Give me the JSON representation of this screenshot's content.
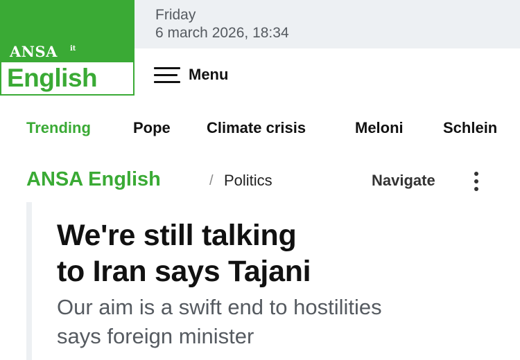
{
  "logo": {
    "brand": "ANSA",
    "brand_suffix": "it",
    "edition": "English"
  },
  "date": {
    "day": "Friday",
    "full": "6 march 2026, 18:34"
  },
  "menu": {
    "label": "Menu",
    "icon": "hamburger-icon"
  },
  "trending": {
    "label": "Trending",
    "items": [
      "Pope",
      "Climate crisis",
      "Meloni",
      "Schlein"
    ]
  },
  "breadcrumb": {
    "home": "ANSA English",
    "separator": "/",
    "section": "Politics"
  },
  "navigate": {
    "label": "Navigate",
    "icon": "kebab-menu-icon"
  },
  "article": {
    "headline_lines": [
      "We're still talking",
      "to Iran says Tajani"
    ],
    "subheadline_lines": [
      "Our aim is a swift end to hostilities",
      "says foreign minister"
    ]
  },
  "colors": {
    "brand_green": "#3aaa35",
    "date_bar_bg": "#edf0f3",
    "text_dark": "#111111",
    "text_muted": "#555a60"
  }
}
